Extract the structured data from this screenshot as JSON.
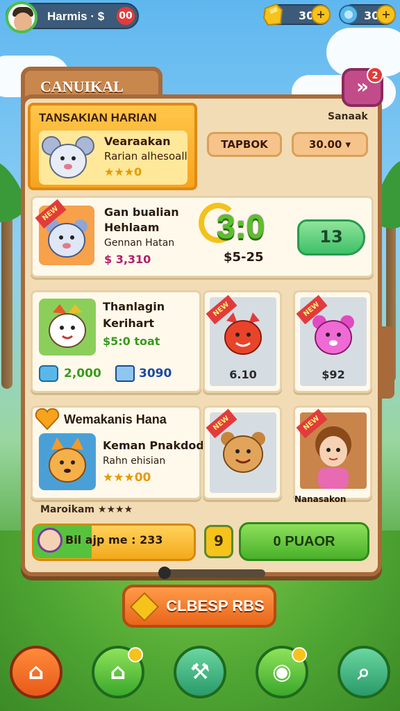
{
  "topbar": {
    "player_name": "Harmis · $",
    "notification_count": "00",
    "currency_gold": "30",
    "currency_gems": "30",
    "plus": "+"
  },
  "board": {
    "tab_title": "CANUIKAL",
    "close_label": "»",
    "close_badge": "2"
  },
  "featured": {
    "title": "TANSAKIAN HARIAN",
    "item_name": "Vearaakan",
    "item_sub": "Rarian alhesoall",
    "item_stars": "★★★0"
  },
  "header_right": {
    "label": "Sanaak",
    "tab_button": "TAPBOK",
    "price_button": "30.00 ▾"
  },
  "list": {
    "card1": {
      "tag": "NEW",
      "line1": "Gan bualian",
      "line2": "Hehlaam",
      "line3": "Gennan Hatan",
      "price": "$ 3,310",
      "score": "3:0",
      "score_sub": "$5-25",
      "action": "13"
    },
    "card2": {
      "line1": "Thanlagin",
      "line2": "Kerihart",
      "line3": "$5:0 toat",
      "stat1": "2,000",
      "stat2": "3090"
    },
    "mini1": {
      "tag": "NEW",
      "price": "6.10"
    },
    "mini2": {
      "tag": "NEW",
      "price": "$92"
    },
    "card3": {
      "title": "Wemakanis Hana",
      "line1": "Keman Pnakdodk",
      "line2": "Rahn ehisian",
      "stars": "★★★00"
    },
    "mini3": {
      "tag": "NEW"
    },
    "mini4": {
      "tag": "NEW",
      "caption": "Nanasakon"
    },
    "rating_label": "Maroikam ★★★★"
  },
  "controls": {
    "invite_label": "Bil ajp me : 233",
    "coin_button": "9",
    "purchase_button": "0 PUAOR",
    "collect_button": "CLBESP RBS"
  },
  "colors": {
    "board": "#f2dcb5",
    "board_border": "#a86a3a",
    "accent_green": "#49b02a",
    "accent_orange": "#e8661a",
    "badge_red": "#e23b3b"
  }
}
